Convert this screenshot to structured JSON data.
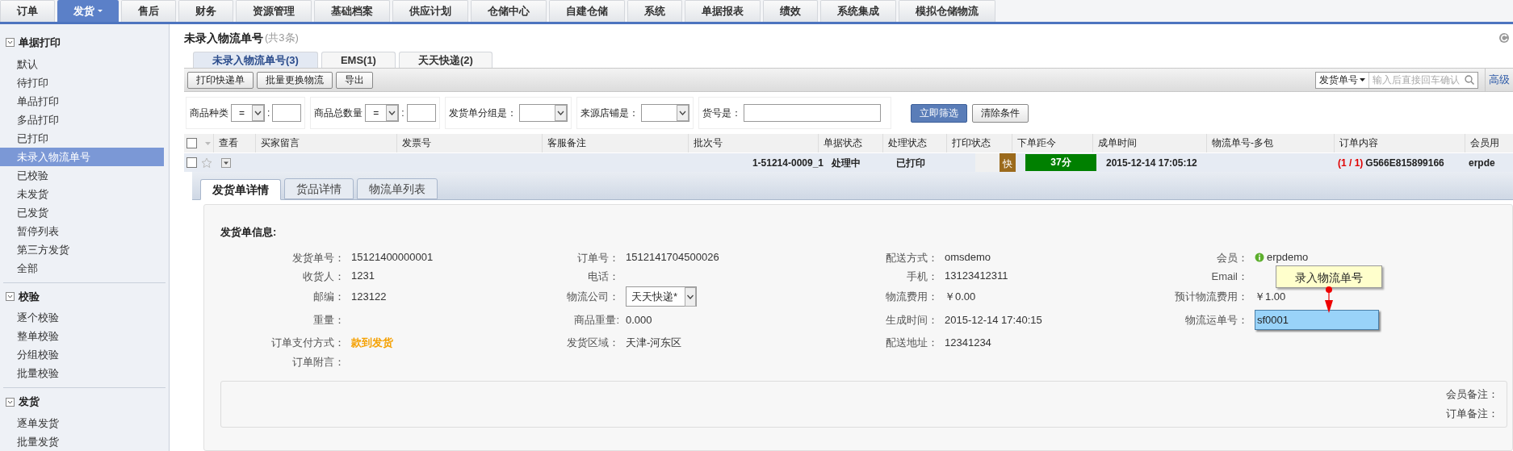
{
  "nav": {
    "items": [
      {
        "label": "订单",
        "selected": false,
        "has_menu": false
      },
      {
        "label": "发货",
        "selected": true,
        "has_menu": true
      },
      {
        "label": "售后",
        "selected": false,
        "has_menu": false
      },
      {
        "label": "财务",
        "selected": false,
        "has_menu": false
      },
      {
        "label": "资源管理",
        "selected": false,
        "has_menu": false
      },
      {
        "label": "基础档案",
        "selected": false,
        "has_menu": false
      },
      {
        "label": "供应计划",
        "selected": false,
        "has_menu": false
      },
      {
        "label": "仓储中心",
        "selected": false,
        "has_menu": false
      },
      {
        "label": "自建仓储",
        "selected": false,
        "has_menu": false
      },
      {
        "label": "系统",
        "selected": false,
        "has_menu": false
      },
      {
        "label": "单据报表",
        "selected": false,
        "has_menu": false
      },
      {
        "label": "绩效",
        "selected": false,
        "has_menu": false
      },
      {
        "label": "系统集成",
        "selected": false,
        "has_menu": false
      },
      {
        "label": "模拟仓储物流",
        "selected": false,
        "has_menu": false
      }
    ]
  },
  "sidebar": {
    "sections": [
      {
        "title": "单据打印",
        "expanded": true,
        "items": [
          {
            "label": "默认",
            "selected": false
          },
          {
            "label": "待打印",
            "selected": false
          },
          {
            "label": "单品打印",
            "selected": false
          },
          {
            "label": "多品打印",
            "selected": false
          },
          {
            "label": "已打印",
            "selected": false
          },
          {
            "label": "未录入物流单号",
            "selected": true
          },
          {
            "label": "已校验",
            "selected": false
          },
          {
            "label": "未发货",
            "selected": false
          },
          {
            "label": "已发货",
            "selected": false
          },
          {
            "label": "暂停列表",
            "selected": false
          },
          {
            "label": "第三方发货",
            "selected": false
          },
          {
            "label": "全部",
            "selected": false
          }
        ]
      },
      {
        "title": "校验",
        "expanded": true,
        "items": [
          {
            "label": "逐个校验",
            "selected": false
          },
          {
            "label": "整单校验",
            "selected": false
          },
          {
            "label": "分组校验",
            "selected": false
          },
          {
            "label": "批量校验",
            "selected": false
          }
        ]
      },
      {
        "title": "发货",
        "expanded": true,
        "items": [
          {
            "label": "逐单发货",
            "selected": false
          },
          {
            "label": "批量发货",
            "selected": false
          }
        ]
      }
    ]
  },
  "page": {
    "title": "未录入物流单号",
    "count": "(共3条)"
  },
  "tabs": [
    {
      "label": "未录入物流单号(3)",
      "selected": true
    },
    {
      "label": "EMS(1)",
      "selected": false
    },
    {
      "label": "天天快递(2)",
      "selected": false
    }
  ],
  "toolbar": {
    "buttons": [
      "打印快递单",
      "批量更换物流",
      "导出"
    ],
    "search": {
      "field": "发货单号",
      "placeholder": "输入后直接回车确认"
    },
    "advanced": "高级"
  },
  "filters": [
    {
      "kind": "compare",
      "label": "商品种类",
      "operator": "=",
      "separator": ":"
    },
    {
      "kind": "compare",
      "label": "商品总数量",
      "operator": "=",
      "separator": ":"
    },
    {
      "kind": "select",
      "label": "发货单分组是："
    },
    {
      "kind": "select",
      "label": "来源店铺是："
    },
    {
      "kind": "input",
      "label": "货号是："
    }
  ],
  "filter_buttons": [
    {
      "label": "立即筛选",
      "kind": "primary"
    },
    {
      "label": "清除条件",
      "kind": "default"
    }
  ],
  "table": {
    "all_checked": false,
    "columns": [
      "查看",
      "买家留言",
      "发票号",
      "客服备注",
      "批次号",
      "单据状态",
      "处理状态",
      "打印状态",
      "下单距今",
      "成单时间",
      "物流单号-多包",
      "订单内容",
      "会员用"
    ],
    "rows": [
      {
        "checked": false,
        "batch": "1-51214-0009_1",
        "doc_status": "处理中",
        "process_status": "已打印",
        "print_badge": "快",
        "elapsed": "37分",
        "created": "2015-12-14 17:05:12",
        "order_count": "(1 / 1)",
        "order_code": "G566E815899166",
        "member": "erpde"
      }
    ]
  },
  "detail": {
    "tabs": [
      {
        "label": "发货单详情",
        "selected": true
      },
      {
        "label": "货品详情",
        "selected": false
      },
      {
        "label": "物流单列表",
        "selected": false
      }
    ],
    "heading": "发货单信息:",
    "rows": [
      [
        {
          "kind": "text",
          "label": "发货单号：",
          "value": "15121400000001"
        },
        {
          "kind": "text",
          "label": "订单号：",
          "value": "1512141704500026"
        },
        {
          "kind": "text",
          "label": "配送方式：",
          "value": "omsdemo"
        },
        {
          "kind": "member",
          "label": "会员：",
          "value": "erpdemo"
        }
      ],
      [
        {
          "kind": "text",
          "label": "收货人：",
          "value": "1231"
        },
        {
          "kind": "text",
          "label": "电话："
        },
        {
          "kind": "text",
          "label": "手机：",
          "value": "13123412311"
        },
        {
          "kind": "text",
          "label": "Email："
        }
      ],
      [
        {
          "kind": "text",
          "label": "邮编：",
          "value": "123122"
        },
        {
          "kind": "select",
          "label": "物流公司：",
          "value": "天天快递*"
        },
        {
          "kind": "text",
          "label": "物流费用：",
          "value": "￥0.00"
        },
        {
          "kind": "text",
          "label": "预计物流费用：",
          "value": "￥1.00"
        }
      ],
      [
        {
          "kind": "text",
          "label": "重量："
        },
        {
          "kind": "text",
          "label": "商品重量:",
          "value": "0.000"
        },
        {
          "kind": "text",
          "label": "生成时间：",
          "value": "2015-12-14 17:40:15"
        },
        {
          "kind": "input",
          "label": "物流运单号：",
          "value": "sf0001"
        }
      ],
      [
        {
          "kind": "highlight",
          "label": "订单支付方式：",
          "value": "款到发货"
        },
        {
          "kind": "text",
          "label": "发货区域：",
          "value": "天津-河东区"
        },
        {
          "kind": "text",
          "label": "配送地址：",
          "value": "12341234"
        }
      ],
      [
        {
          "kind": "text",
          "label": "订单附言："
        }
      ]
    ],
    "notes": [
      "会员备注：",
      "订单备注："
    ],
    "tooltip": "录入物流单号"
  }
}
